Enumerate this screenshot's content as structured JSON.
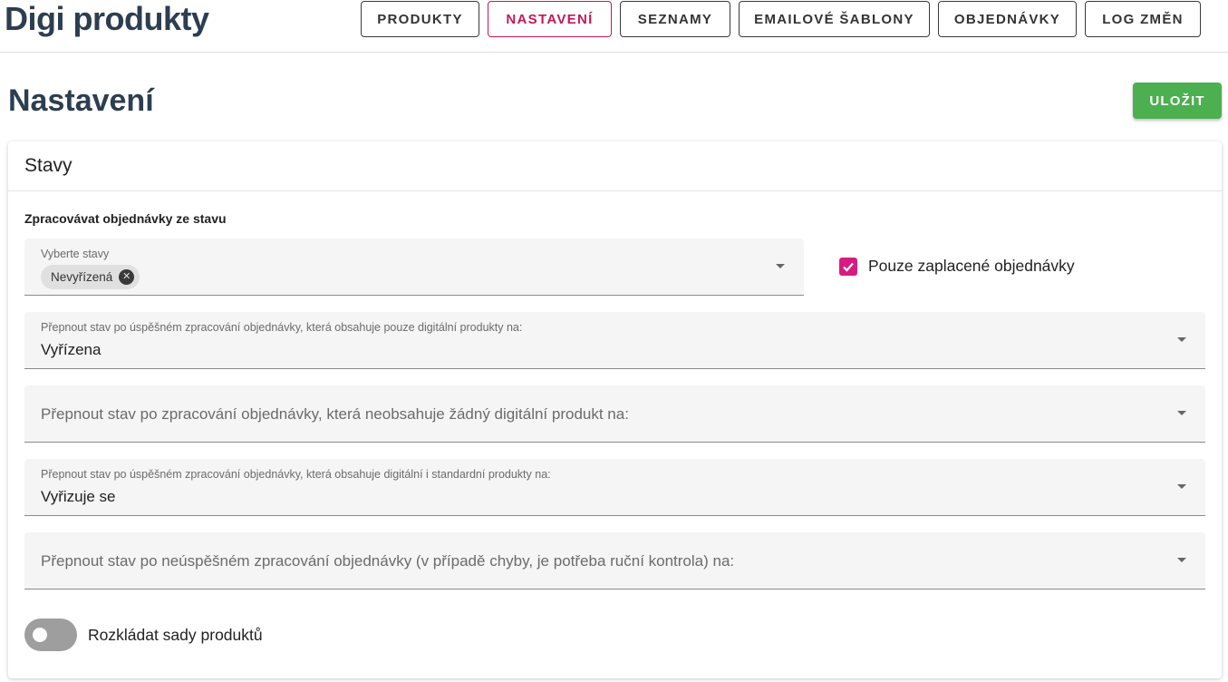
{
  "app_title": "Digi produkty",
  "nav": [
    {
      "label": "PRODUKTY",
      "active": false
    },
    {
      "label": "NASTAVENÍ",
      "active": true
    },
    {
      "label": "SEZNAMY",
      "active": false
    },
    {
      "label": "EMAILOVÉ ŠABLONY",
      "active": false
    },
    {
      "label": "OBJEDNÁVKY",
      "active": false
    },
    {
      "label": "LOG ZMĚN",
      "active": false
    }
  ],
  "page_title": "Nastavení",
  "save_label": "ULOŽIT",
  "card": {
    "title": "Stavy",
    "section_label": "Zpracovávat objednávky ze stavu",
    "states_select": {
      "label": "Vyberte stavy",
      "chips": [
        "Nevyřízená"
      ]
    },
    "paid_only": {
      "label": "Pouze zaplacené objednávky",
      "checked": true
    },
    "fields": [
      {
        "label": "Přepnout stav po úspěšném zpracování objednávky, která obsahuje pouze digitální produkty na:",
        "value": "Vyřízena"
      },
      {
        "label": "Přepnout stav po zpracování objednávky, která neobsahuje žádný digitální produkt na:",
        "value": ""
      },
      {
        "label": "Přepnout stav po úspěšném zpracování objednávky, která obsahuje digitální i standardní produkty na:",
        "value": "Vyřizuje se"
      },
      {
        "label": "Přepnout stav po neúspěšném zpracování objednávky (v případě chyby, je potřeba ruční kontrola) na:",
        "value": ""
      }
    ],
    "split_sets": {
      "label": "Rozkládat sady produktů",
      "on": false
    }
  },
  "colors": {
    "accent": "#d81b80",
    "save": "#4caf50",
    "title": "#2c3e50"
  }
}
